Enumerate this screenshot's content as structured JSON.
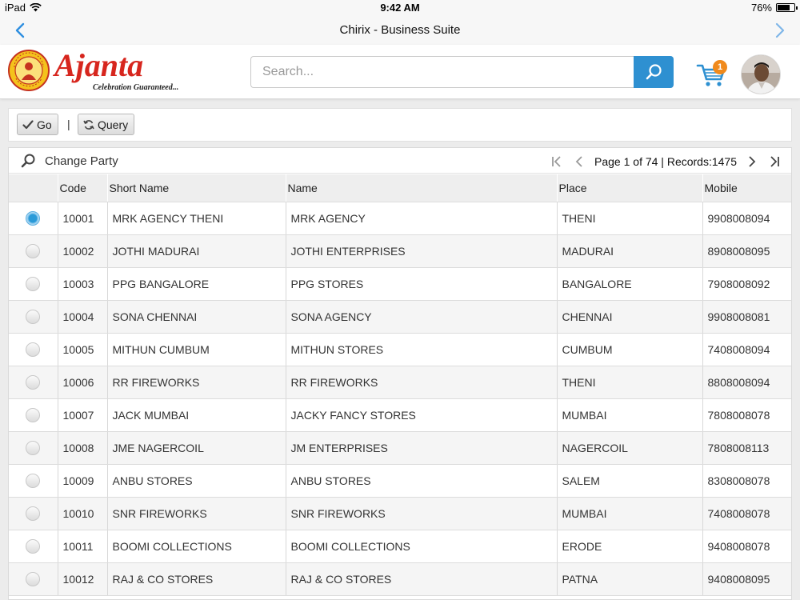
{
  "status_bar": {
    "device": "iPad",
    "time": "9:42 AM",
    "battery": "76%"
  },
  "nav": {
    "title": "Chirix - Business Suite"
  },
  "header": {
    "brand_name": "Ajanta",
    "brand_tagline": "Celebration Guaranteed...",
    "seal_text": "AJANTA BRAND",
    "seal_sub": "TRADE MARK",
    "search_placeholder": "Search...",
    "cart_count": "1"
  },
  "toolbar": {
    "go_label": "Go",
    "separator": "|",
    "query_label": "Query"
  },
  "grid": {
    "caption": "Change Party",
    "pager_text": "Page 1 of 74 | Records:1475",
    "columns": [
      "Code",
      "Short Name",
      "Name",
      "Place",
      "Mobile"
    ],
    "rows": [
      {
        "selected": true,
        "code": "10001",
        "short_name": "MRK AGENCY THENI",
        "name": "MRK AGENCY",
        "place": "THENI",
        "mobile": "9908008094"
      },
      {
        "selected": false,
        "code": "10002",
        "short_name": "JOTHI MADURAI",
        "name": "JOTHI ENTERPRISES",
        "place": "MADURAI",
        "mobile": "8908008095"
      },
      {
        "selected": false,
        "code": "10003",
        "short_name": "PPG BANGALORE",
        "name": "PPG STORES",
        "place": "BANGALORE",
        "mobile": "7908008092"
      },
      {
        "selected": false,
        "code": "10004",
        "short_name": "SONA CHENNAI",
        "name": "SONA AGENCY",
        "place": "CHENNAI",
        "mobile": "9908008081"
      },
      {
        "selected": false,
        "code": "10005",
        "short_name": "MITHUN CUMBUM",
        "name": "MITHUN STORES",
        "place": "CUMBUM",
        "mobile": "7408008094"
      },
      {
        "selected": false,
        "code": "10006",
        "short_name": "RR FIREWORKS",
        "name": "RR FIREWORKS",
        "place": "THENI",
        "mobile": "8808008094"
      },
      {
        "selected": false,
        "code": "10007",
        "short_name": "JACK MUMBAI",
        "name": "JACKY FANCY STORES",
        "place": "MUMBAI",
        "mobile": "7808008078"
      },
      {
        "selected": false,
        "code": "10008",
        "short_name": "JME NAGERCOIL",
        "name": "JM ENTERPRISES",
        "place": "NAGERCOIL",
        "mobile": "7808008113"
      },
      {
        "selected": false,
        "code": "10009",
        "short_name": "ANBU STORES",
        "name": "ANBU STORES",
        "place": "SALEM",
        "mobile": "8308008078"
      },
      {
        "selected": false,
        "code": "10010",
        "short_name": "SNR FIREWORKS",
        "name": "SNR FIREWORKS",
        "place": "MUMBAI",
        "mobile": "7408008078"
      },
      {
        "selected": false,
        "code": "10011",
        "short_name": "BOOMI COLLECTIONS",
        "name": "BOOMI COLLECTIONS",
        "place": "ERODE",
        "mobile": "9408008078"
      },
      {
        "selected": false,
        "code": "10012",
        "short_name": "RAJ & CO STORES",
        "name": "RAJ & CO STORES",
        "place": "PATNA",
        "mobile": "9408008095"
      }
    ]
  },
  "colors": {
    "accent": "#2e90d1",
    "brand_red": "#d7261e",
    "badge_orange": "#f08a1c",
    "nav_blue": "#2e8fe0"
  }
}
